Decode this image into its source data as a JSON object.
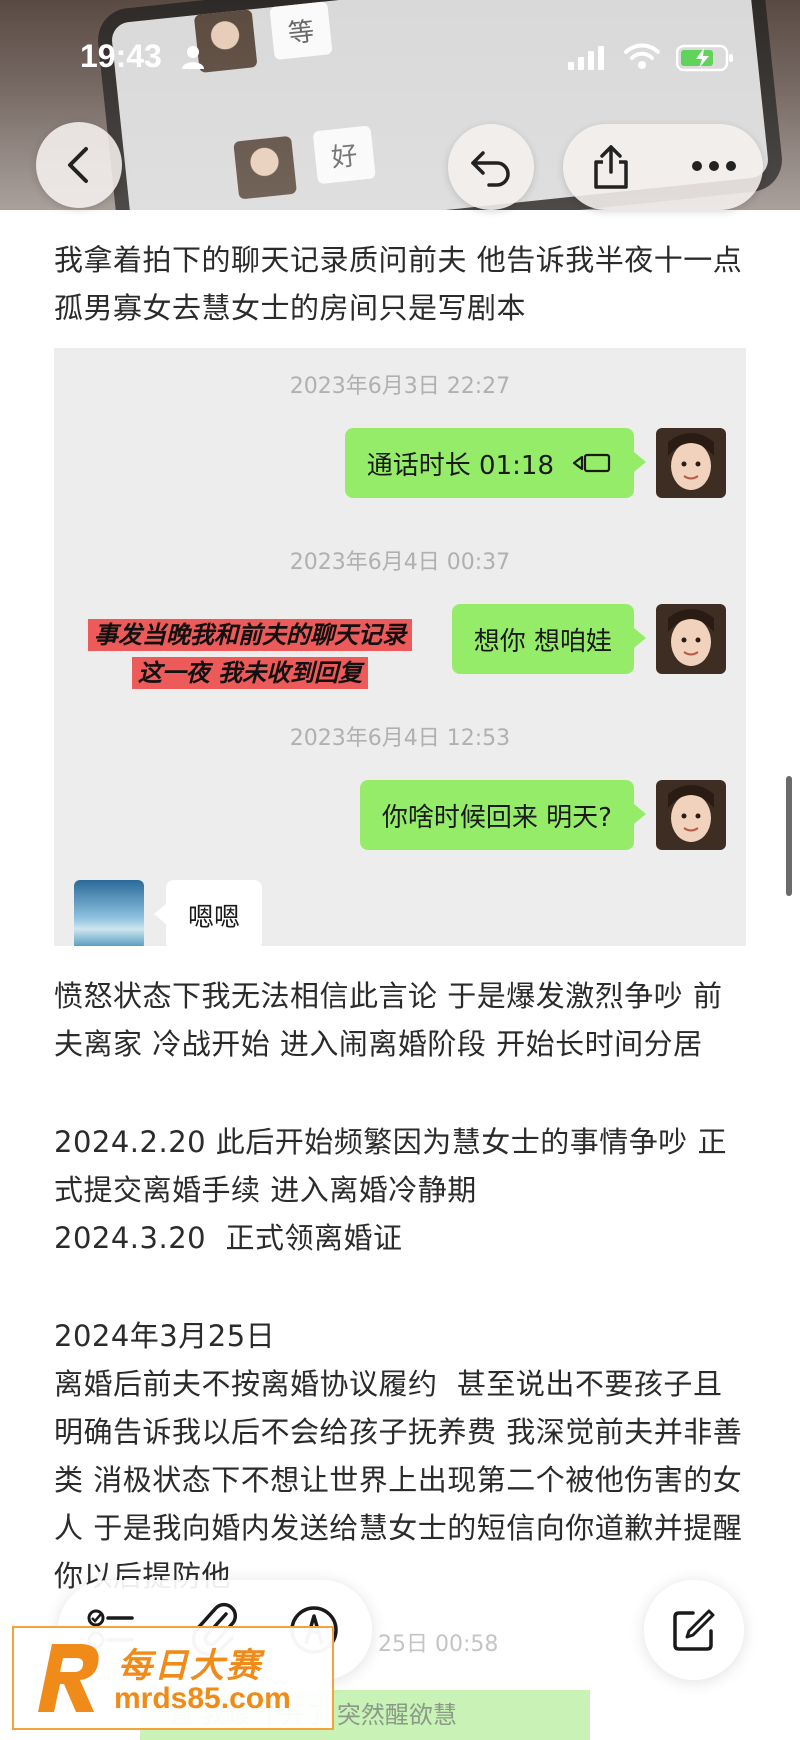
{
  "status_bar": {
    "time": "19:43"
  },
  "top_photo": {
    "ghost_text_1": "等",
    "ghost_text_2": "好"
  },
  "intro_text": "我拿着拍下的聊天记录质问前夫 他告诉我半夜十一点孤男寡女去慧女士的房间只是写剧本",
  "chat_screenshot": {
    "ts1": "2023年6月3日 22:27",
    "msg1": "通话时长 01:18",
    "ts2": "2023年6月4日 00:37",
    "msg2": "想你 想咱娃",
    "ts3": "2023年6月4日 12:53",
    "msg3": "你啥时候回来 明天?",
    "msg4": "嗯嗯",
    "annotation_line1": "事发当晚我和前夫的聊天记录",
    "annotation_line2": "这一夜 我未收到回复"
  },
  "angry_text": "愤怒状态下我无法相信此言论 于是爆发激烈争吵 前夫离家 冷战开始 进入闹离婚阶段 开始长时间分居",
  "dates_text": "2024.2.20 此后开始频繁因为慧女士的事情争吵 正式提交离婚手续 进入离婚冷静期\n2024.3.20  正式领离婚证",
  "mar25_text": "2024年3月25日\n离婚后前夫不按离婚协议履约  甚至说出不要孩子且明确告诉我以后不会给孩子抚养费 我深觉前夫并非善类 消极状态下不想让世界上出现第二个被他伤害的女人 于是我向婚内发送给慧女士的短信向你道歉并提醒你以后提防他",
  "bottom_peek": {
    "ts": "25日 00:58",
    "green_text": "慧 我跟 个开了  突然醒欲慧"
  },
  "watermark": {
    "cn": "每日大赛",
    "url": "mrds85.com"
  },
  "colors": {
    "chat_bg": "#ededed",
    "bubble_green": "#95ec69",
    "annotation_red": "#ec5a59",
    "watermark_orange": "#f08a18"
  }
}
